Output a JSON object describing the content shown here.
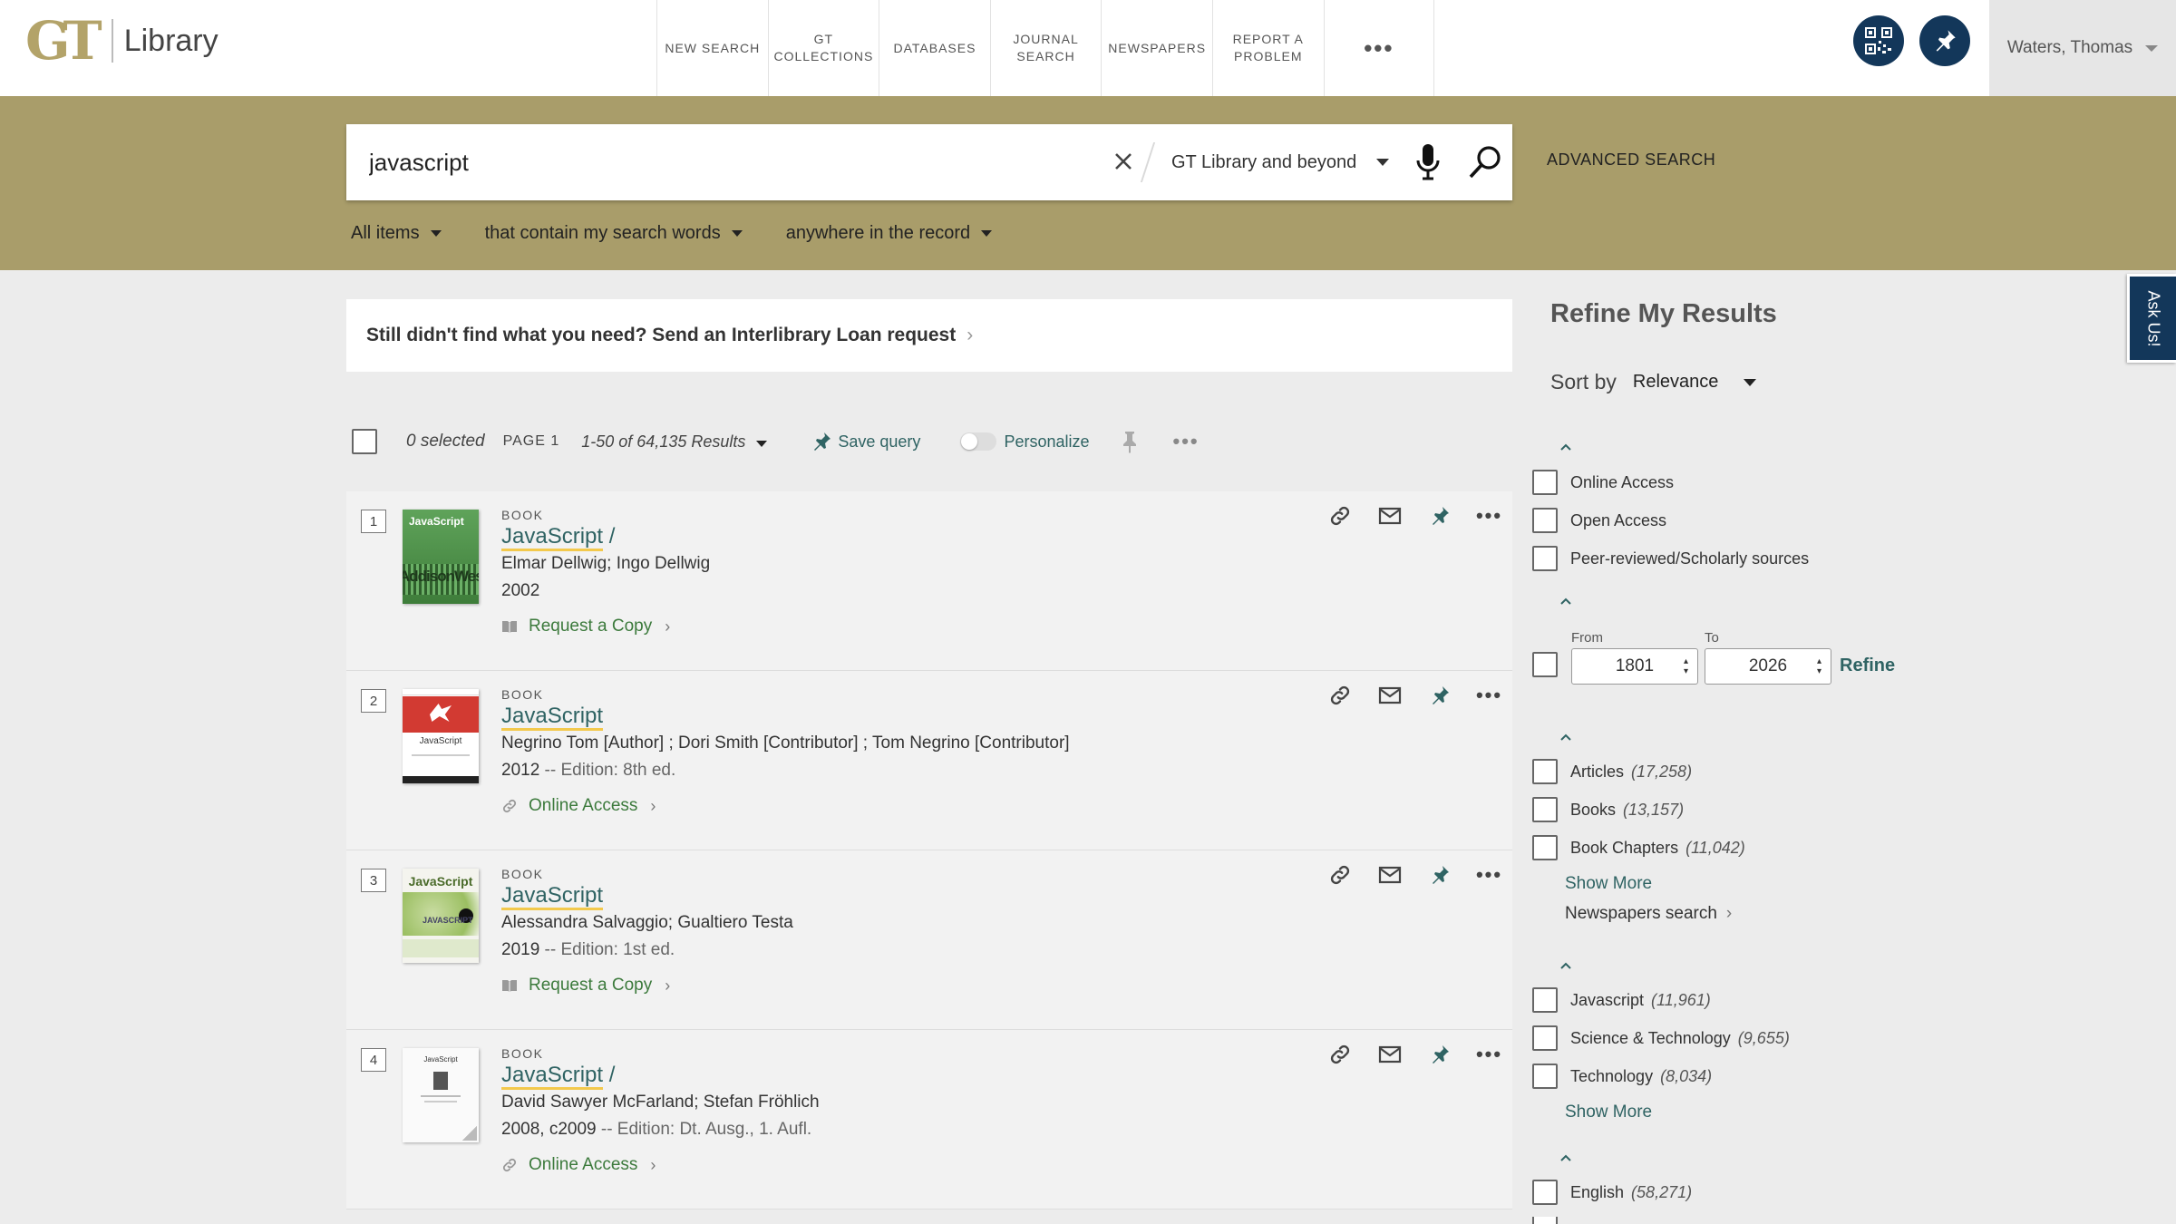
{
  "header": {
    "logo_mark": "GT",
    "logo_text": "Library",
    "nav": [
      {
        "label": "NEW SEARCH"
      },
      {
        "label": "GT\nCOLLECTIONS"
      },
      {
        "label": "DATABASES"
      },
      {
        "label": "JOURNAL\nSEARCH"
      },
      {
        "label": "NEWSPAPERS"
      },
      {
        "label": "REPORT A\nPROBLEM"
      },
      {
        "label": "•••"
      }
    ],
    "user_name": "Waters, Thomas",
    "icons": [
      "qr-code-icon",
      "pin-icon"
    ]
  },
  "search": {
    "query": "javascript",
    "scope": "GT Library and beyond",
    "advanced_label": "ADVANCED SEARCH",
    "filters": [
      "All items",
      "that contain my search words",
      "anywhere in the record"
    ]
  },
  "ill_banner": {
    "text": "Still didn't find what you need? Send an Interlibrary Loan request",
    "chevron": "›"
  },
  "results_bar": {
    "selected": "0 selected",
    "page": "PAGE 1",
    "count": "1-50 of 64,135 Results",
    "save_query": "Save query",
    "personalize": "Personalize",
    "more": "•••"
  },
  "results": [
    {
      "num": "1",
      "type": "BOOK",
      "title": "JavaScript",
      "title_suffix": " /",
      "authors": "Elmar Dellwig; Ingo Dellwig",
      "year": "2002",
      "edition": "",
      "access": "Request a Copy",
      "access_icon": "book-icon"
    },
    {
      "num": "2",
      "type": "BOOK",
      "title": "JavaScript",
      "title_suffix": "",
      "authors": "Negrino Tom [Author] ; Dori Smith [Contributor] ; Tom Negrino [Contributor]",
      "year": "2012",
      "edition": " -- Edition: 8th ed.",
      "access": "Online Access",
      "access_icon": "link-icon"
    },
    {
      "num": "3",
      "type": "BOOK",
      "title": "JavaScript",
      "title_suffix": "",
      "authors": "Alessandra Salvaggio; Gualtiero Testa",
      "year": "2019",
      "edition": " -- Edition: 1st ed.",
      "access": "Request a Copy",
      "access_icon": "book-icon"
    },
    {
      "num": "4",
      "type": "BOOK",
      "title": "JavaScript",
      "title_suffix": " /",
      "authors": "David Sawyer McFarland; Stefan Fröhlich",
      "year": "2008, c2009",
      "edition": " -- Edition: Dt. Ausg., 1. Aufl.",
      "access": "Online Access",
      "access_icon": "link-icon"
    }
  ],
  "thumbnails": {
    "t1_title": "JavaScript",
    "t1_pub": "AddisonWesley",
    "t2_title": "JavaScript",
    "t3_title": "JavaScript",
    "t3_tag": "JAVASCRIPT",
    "t4_title": "JavaScript"
  },
  "refine": {
    "title": "Refine My Results",
    "sort_label": "Sort by",
    "sort_value": "Relevance",
    "availability": [
      {
        "label": "Online Access"
      },
      {
        "label": "Open Access"
      },
      {
        "label": "Peer-reviewed/Scholarly sources"
      }
    ],
    "date": {
      "from_label": "From",
      "to_label": "To",
      "from": "1801",
      "to": "2026",
      "refine_label": "Refine"
    },
    "resource_types": [
      {
        "label": "Articles",
        "count": "(17,258)"
      },
      {
        "label": "Books",
        "count": "(13,157)"
      },
      {
        "label": "Book Chapters",
        "count": "(11,042)"
      }
    ],
    "show_more": "Show More",
    "newspapers": "Newspapers search",
    "subjects": [
      {
        "label": "Javascript",
        "count": "(11,961)"
      },
      {
        "label": "Science & Technology",
        "count": "(9,655)"
      },
      {
        "label": "Technology",
        "count": "(8,034)"
      }
    ],
    "languages": [
      {
        "label": "English",
        "count": "(58,271)"
      }
    ]
  },
  "ask_us": "Ask Us!",
  "colors": {
    "gold": "#a99d6a",
    "navy": "#13375a",
    "teal": "#2f6363",
    "green": "#3c7a3c",
    "highlight": "#f3c94c"
  }
}
